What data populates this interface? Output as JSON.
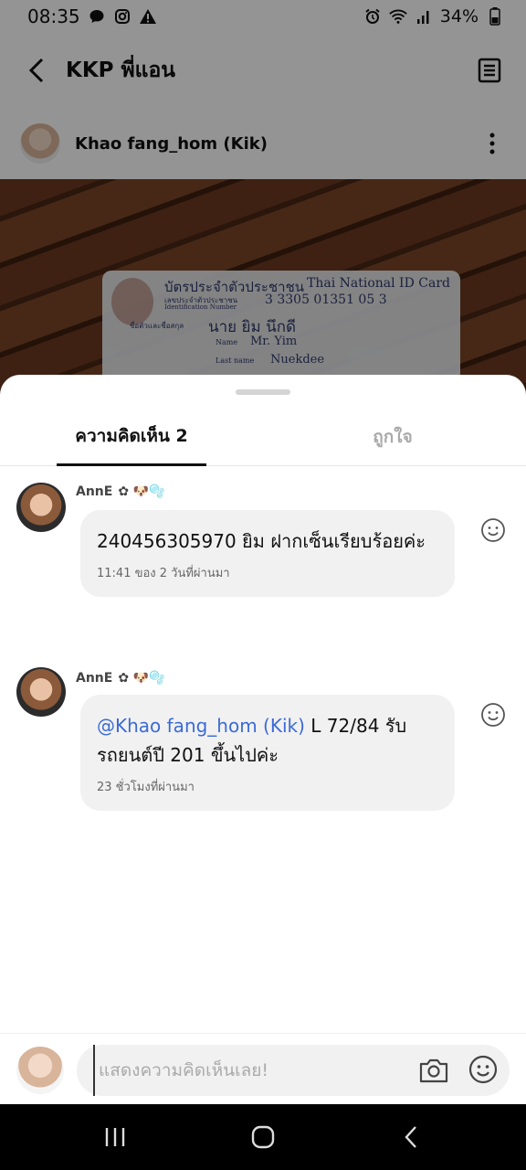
{
  "status_bar": {
    "time": "08:35",
    "battery": "34%"
  },
  "header": {
    "title": "KKP พี่แอน"
  },
  "post": {
    "author_name": "Khao fang_hom (Kik)",
    "id_card": {
      "title_th": "บัตรประจำตัวประชาชน",
      "title_en": "Thai National ID Card",
      "id_label_th": "เลขประจำตัวประชาชน",
      "id_label_en": "Identification Number",
      "id_number": "3 3305 01351 05 3",
      "name_label": "ชื่อตัวและชื่อสกุล",
      "name_th": "นาย ยิม  นึกดี",
      "name_label_en": "Name",
      "name_en": "Mr. Yim",
      "lastname_label_en": "Last name",
      "lastname_en": "Nuekdee"
    }
  },
  "tabs": {
    "comments": "ความคิดเห็น 2",
    "likes": "ถูกใจ"
  },
  "comments": [
    {
      "name": "AnnE",
      "badges": "✿ 🐶🫧",
      "mention": "",
      "text": "240456305970 ยิม ฝากเซ็นเรียบร้อยค่ะ",
      "time": "11:41 ของ 2 วันที่ผ่านมา"
    },
    {
      "name": "AnnE",
      "badges": "✿ 🐶🫧",
      "mention": "@Khao fang_hom (Kik)",
      "text": " L 72/84 รับรถยนต์ปี 201 ขึ้นไปค่ะ",
      "time": "23 ชั่วโมงที่ผ่านมา"
    }
  ],
  "input": {
    "placeholder": "แสดงความคิดเห็นเลย!",
    "value": ""
  }
}
